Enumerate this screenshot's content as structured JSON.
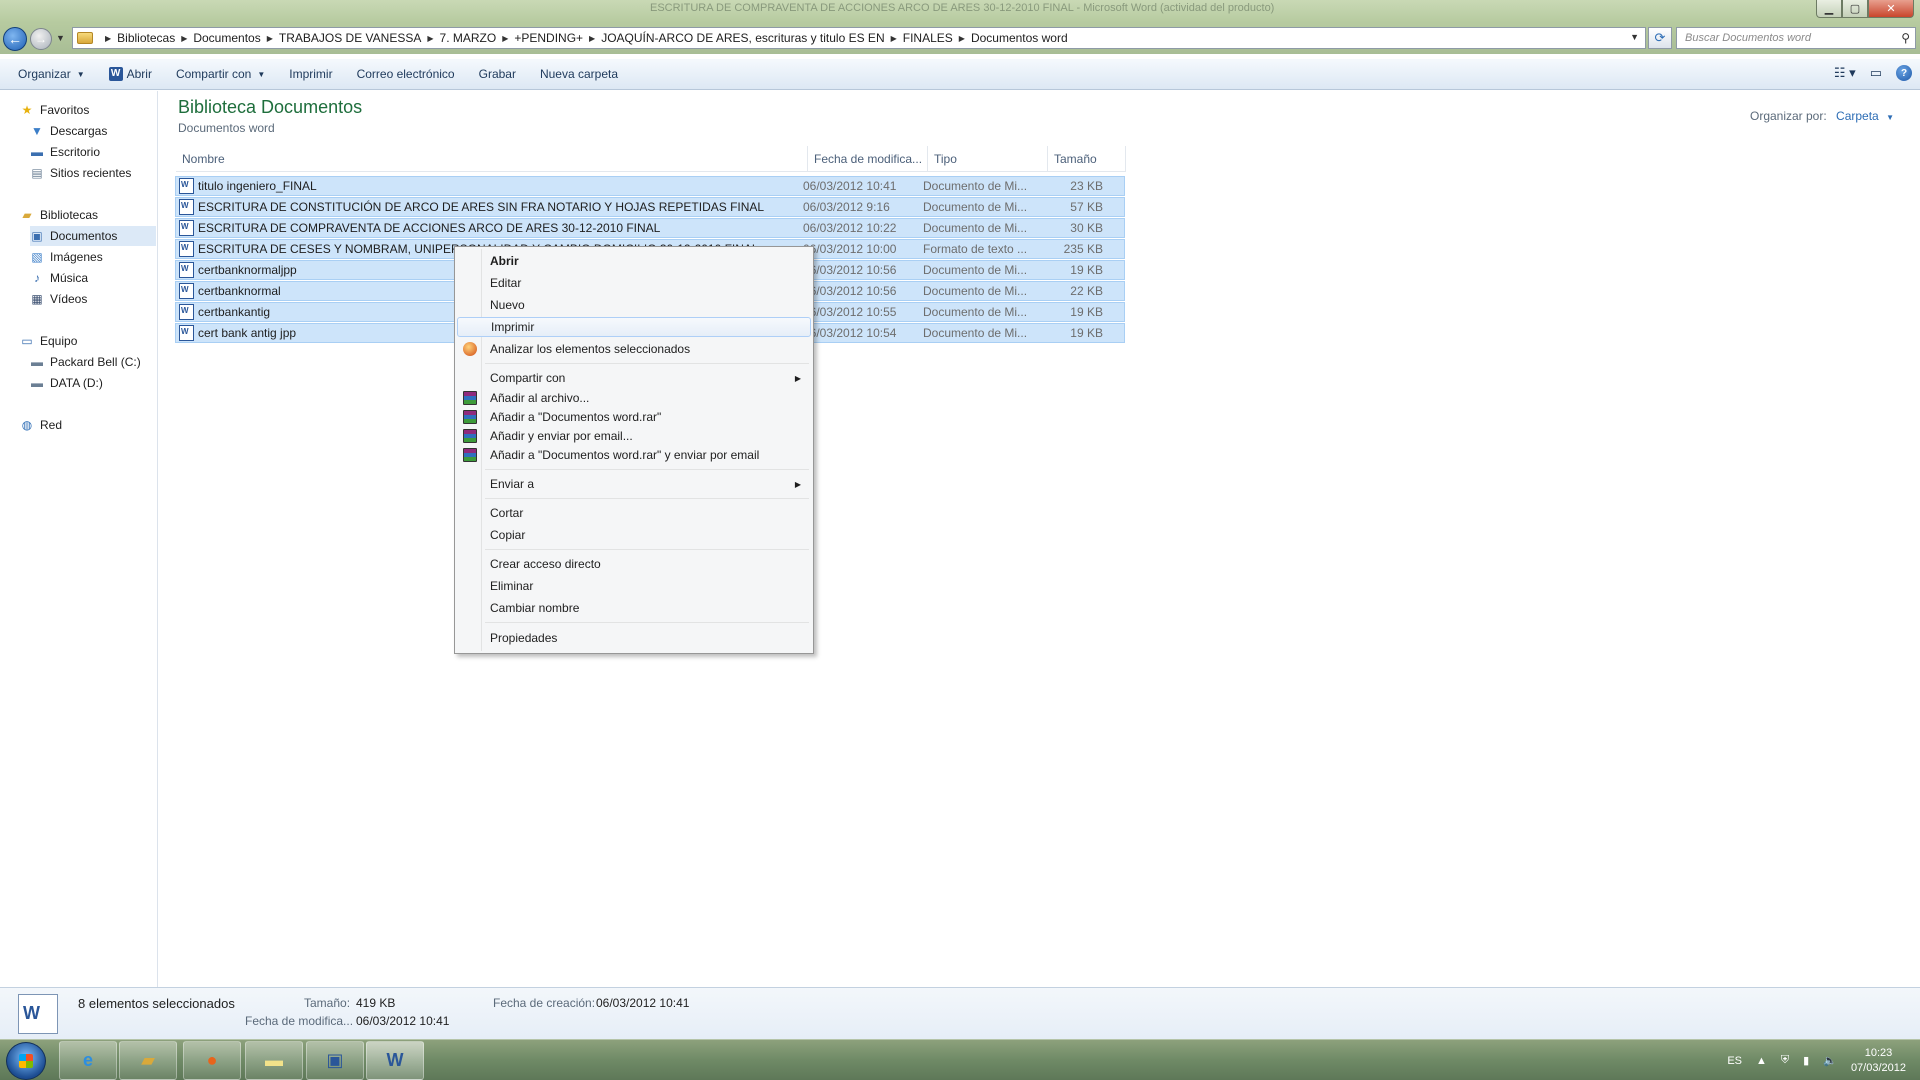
{
  "window": {
    "title": "ESCRITURA DE COMPRAVENTA DE ACCIONES ARCO DE ARES 30-12-2010 FINAL - Microsoft Word (actividad del producto)"
  },
  "address": {
    "crumbs": [
      "Bibliotecas",
      "Documentos",
      "TRABAJOS DE VANESSA",
      "7. MARZO",
      "+PENDING+",
      "JOAQUÍN-ARCO DE ARES, escrituras y titulo ES EN",
      "FINALES",
      "Documentos word"
    ],
    "search_placeholder": "Buscar Documentos word"
  },
  "toolbar": {
    "organize": "Organizar",
    "open": "Abrir",
    "share": "Compartir con",
    "print": "Imprimir",
    "email": "Correo electrónico",
    "burn": "Grabar",
    "new_folder": "Nueva carpeta"
  },
  "nav": {
    "favorites": "Favoritos",
    "downloads": "Descargas",
    "desktop": "Escritorio",
    "recent": "Sitios recientes",
    "libraries": "Bibliotecas",
    "documents": "Documentos",
    "images": "Imágenes",
    "music": "Música",
    "videos": "Vídeos",
    "computer": "Equipo",
    "drive_c": "Packard Bell (C:)",
    "drive_d": "DATA (D:)",
    "network": "Red"
  },
  "library": {
    "title": "Biblioteca Documentos",
    "subtitle": "Documentos word",
    "arrange_label": "Organizar por:",
    "arrange_value": "Carpeta"
  },
  "columns": {
    "name": "Nombre",
    "date": "Fecha de modifica...",
    "type": "Tipo",
    "size": "Tamaño"
  },
  "files": [
    {
      "name": "titulo ingeniero_FINAL",
      "date": "06/03/2012 10:41",
      "type": "Documento de Mi...",
      "size": "23 KB"
    },
    {
      "name": "ESCRITURA DE CONSTITUCIÓN DE ARCO DE ARES SIN FRA NOTARIO Y HOJAS REPETIDAS FINAL",
      "date": "06/03/2012 9:16",
      "type": "Documento de Mi...",
      "size": "57 KB"
    },
    {
      "name": "ESCRITURA DE COMPRAVENTA DE ACCIONES ARCO DE ARES 30-12-2010 FINAL",
      "date": "06/03/2012 10:22",
      "type": "Documento de Mi...",
      "size": "30 KB"
    },
    {
      "name": "ESCRITURA DE CESES Y NOMBRAM,      UNIPERSONALIDAD Y CAMBIO DOMICILIO 30-12-2010 FINAL",
      "date": "06/03/2012 10:00",
      "type": "Formato de texto ...",
      "size": "235 KB"
    },
    {
      "name": "certbanknormaljpp",
      "date": "06/03/2012 10:56",
      "type": "Documento de Mi...",
      "size": "19 KB"
    },
    {
      "name": "certbanknormal",
      "date": "06/03/2012 10:56",
      "type": "Documento de Mi...",
      "size": "22 KB"
    },
    {
      "name": "certbankantig",
      "date": "06/03/2012 10:55",
      "type": "Documento de Mi...",
      "size": "19 KB"
    },
    {
      "name": "cert bank antig jpp",
      "date": "06/03/2012 10:54",
      "type": "Documento de Mi...",
      "size": "19 KB"
    }
  ],
  "menu": {
    "open": "Abrir",
    "edit": "Editar",
    "new": "Nuevo",
    "print": "Imprimir",
    "scan": "Analizar los elementos seleccionados",
    "share": "Compartir con",
    "add_archive": "Añadir al archivo...",
    "add_rar": "Añadir a \"Documentos word.rar\"",
    "add_email": "Añadir y enviar por email...",
    "add_rar_email": "Añadir a \"Documentos word.rar\" y enviar por email",
    "send_to": "Enviar a",
    "cut": "Cortar",
    "copy": "Copiar",
    "shortcut": "Crear acceso directo",
    "delete": "Eliminar",
    "rename": "Cambiar nombre",
    "properties": "Propiedades"
  },
  "details": {
    "selected": "8 elementos seleccionados",
    "size_label": "Tamaño:",
    "size_value": "419 KB",
    "created_label": "Fecha de creación:",
    "created_value": "06/03/2012 10:41",
    "modified_label": "Fecha de modifica...",
    "modified_value": "06/03/2012 10:41"
  },
  "taskbar": {
    "lang": "ES",
    "time": "10:23",
    "date": "07/03/2012"
  }
}
